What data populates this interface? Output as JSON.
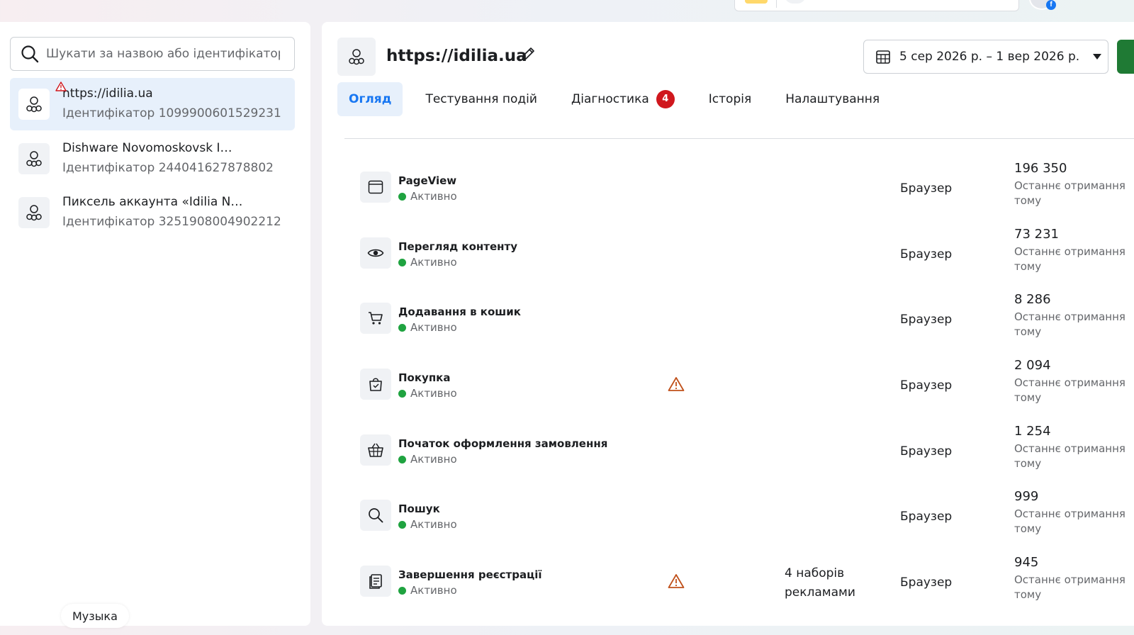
{
  "left_panel": {
    "search_placeholder": "Шукати за назвою або ідентифікатором",
    "pixels": [
      {
        "name": "https://idilia.ua",
        "id": "Ідентифікатор 1099900601529231",
        "icon": "pixel-icon",
        "warning": true
      },
      {
        "name": "Dishware Novomoskovsk I…",
        "id": "Ідентифікатор 244041627878802",
        "icon": "pixel-icon"
      },
      {
        "name": "Пиксель аккаунта «Idilia N…",
        "id": "Ідентифікатор 3251908004902212",
        "icon": "pixel-icon"
      }
    ]
  },
  "music_label": "Музыка",
  "main": {
    "title": "https://idilia.ua",
    "date_range": "5 сер 2026 р. – 1 вер 2026 р.",
    "tabs": [
      {
        "label": "Огляд",
        "active": true
      },
      {
        "label": "Тестування подій"
      },
      {
        "label": "Діагностика",
        "badge": "4"
      },
      {
        "label": "Історія"
      },
      {
        "label": "Налаштування"
      }
    ],
    "events": [
      {
        "name": "PageView",
        "status": "Активно",
        "icon": "browser-window-icon",
        "source": "Браузер",
        "count": "196 350",
        "received": "Останнє отримання",
        "received2": "тому"
      },
      {
        "name": "Перегляд контенту",
        "status": "Активно",
        "icon": "eye-icon",
        "source": "Браузер",
        "count": "73 231",
        "received": "Останнє отримання",
        "received2": "тому"
      },
      {
        "name": "Додавання в кошик",
        "status": "Активно",
        "icon": "cart-icon",
        "source": "Браузер",
        "count": "8 286",
        "received": "Останнє отримання",
        "received2": "тому"
      },
      {
        "name": "Покупка",
        "status": "Активно",
        "icon": "shopping-bag-icon",
        "warning": true,
        "source": "Браузер",
        "count": "2 094",
        "received": "Останнє отримання",
        "received2": "тому"
      },
      {
        "name": "Початок оформлення замовлення",
        "status": "Активно",
        "icon": "basket-icon",
        "source": "Браузер",
        "count": "1 254",
        "received": "Останнє отримання",
        "received2": "тому"
      },
      {
        "name": "Пошук",
        "status": "Активно",
        "icon": "search-icon",
        "source": "Браузер",
        "count": "999",
        "received": "Останнє отримання",
        "received2": "тому"
      },
      {
        "name": "Завершення реєстрації",
        "status": "Активно",
        "icon": "registration-icon",
        "warning": true,
        "adsets": "4 наборів рекламами",
        "source": "Браузер",
        "count": "945",
        "received": "Останнє отримання",
        "received2": "тому"
      }
    ]
  },
  "colors": {
    "accent": "#1877f2",
    "active_status": "#1fa340",
    "badge": "#d0171d",
    "warning": "#c0501a",
    "primary_button": "#1f7a34"
  }
}
